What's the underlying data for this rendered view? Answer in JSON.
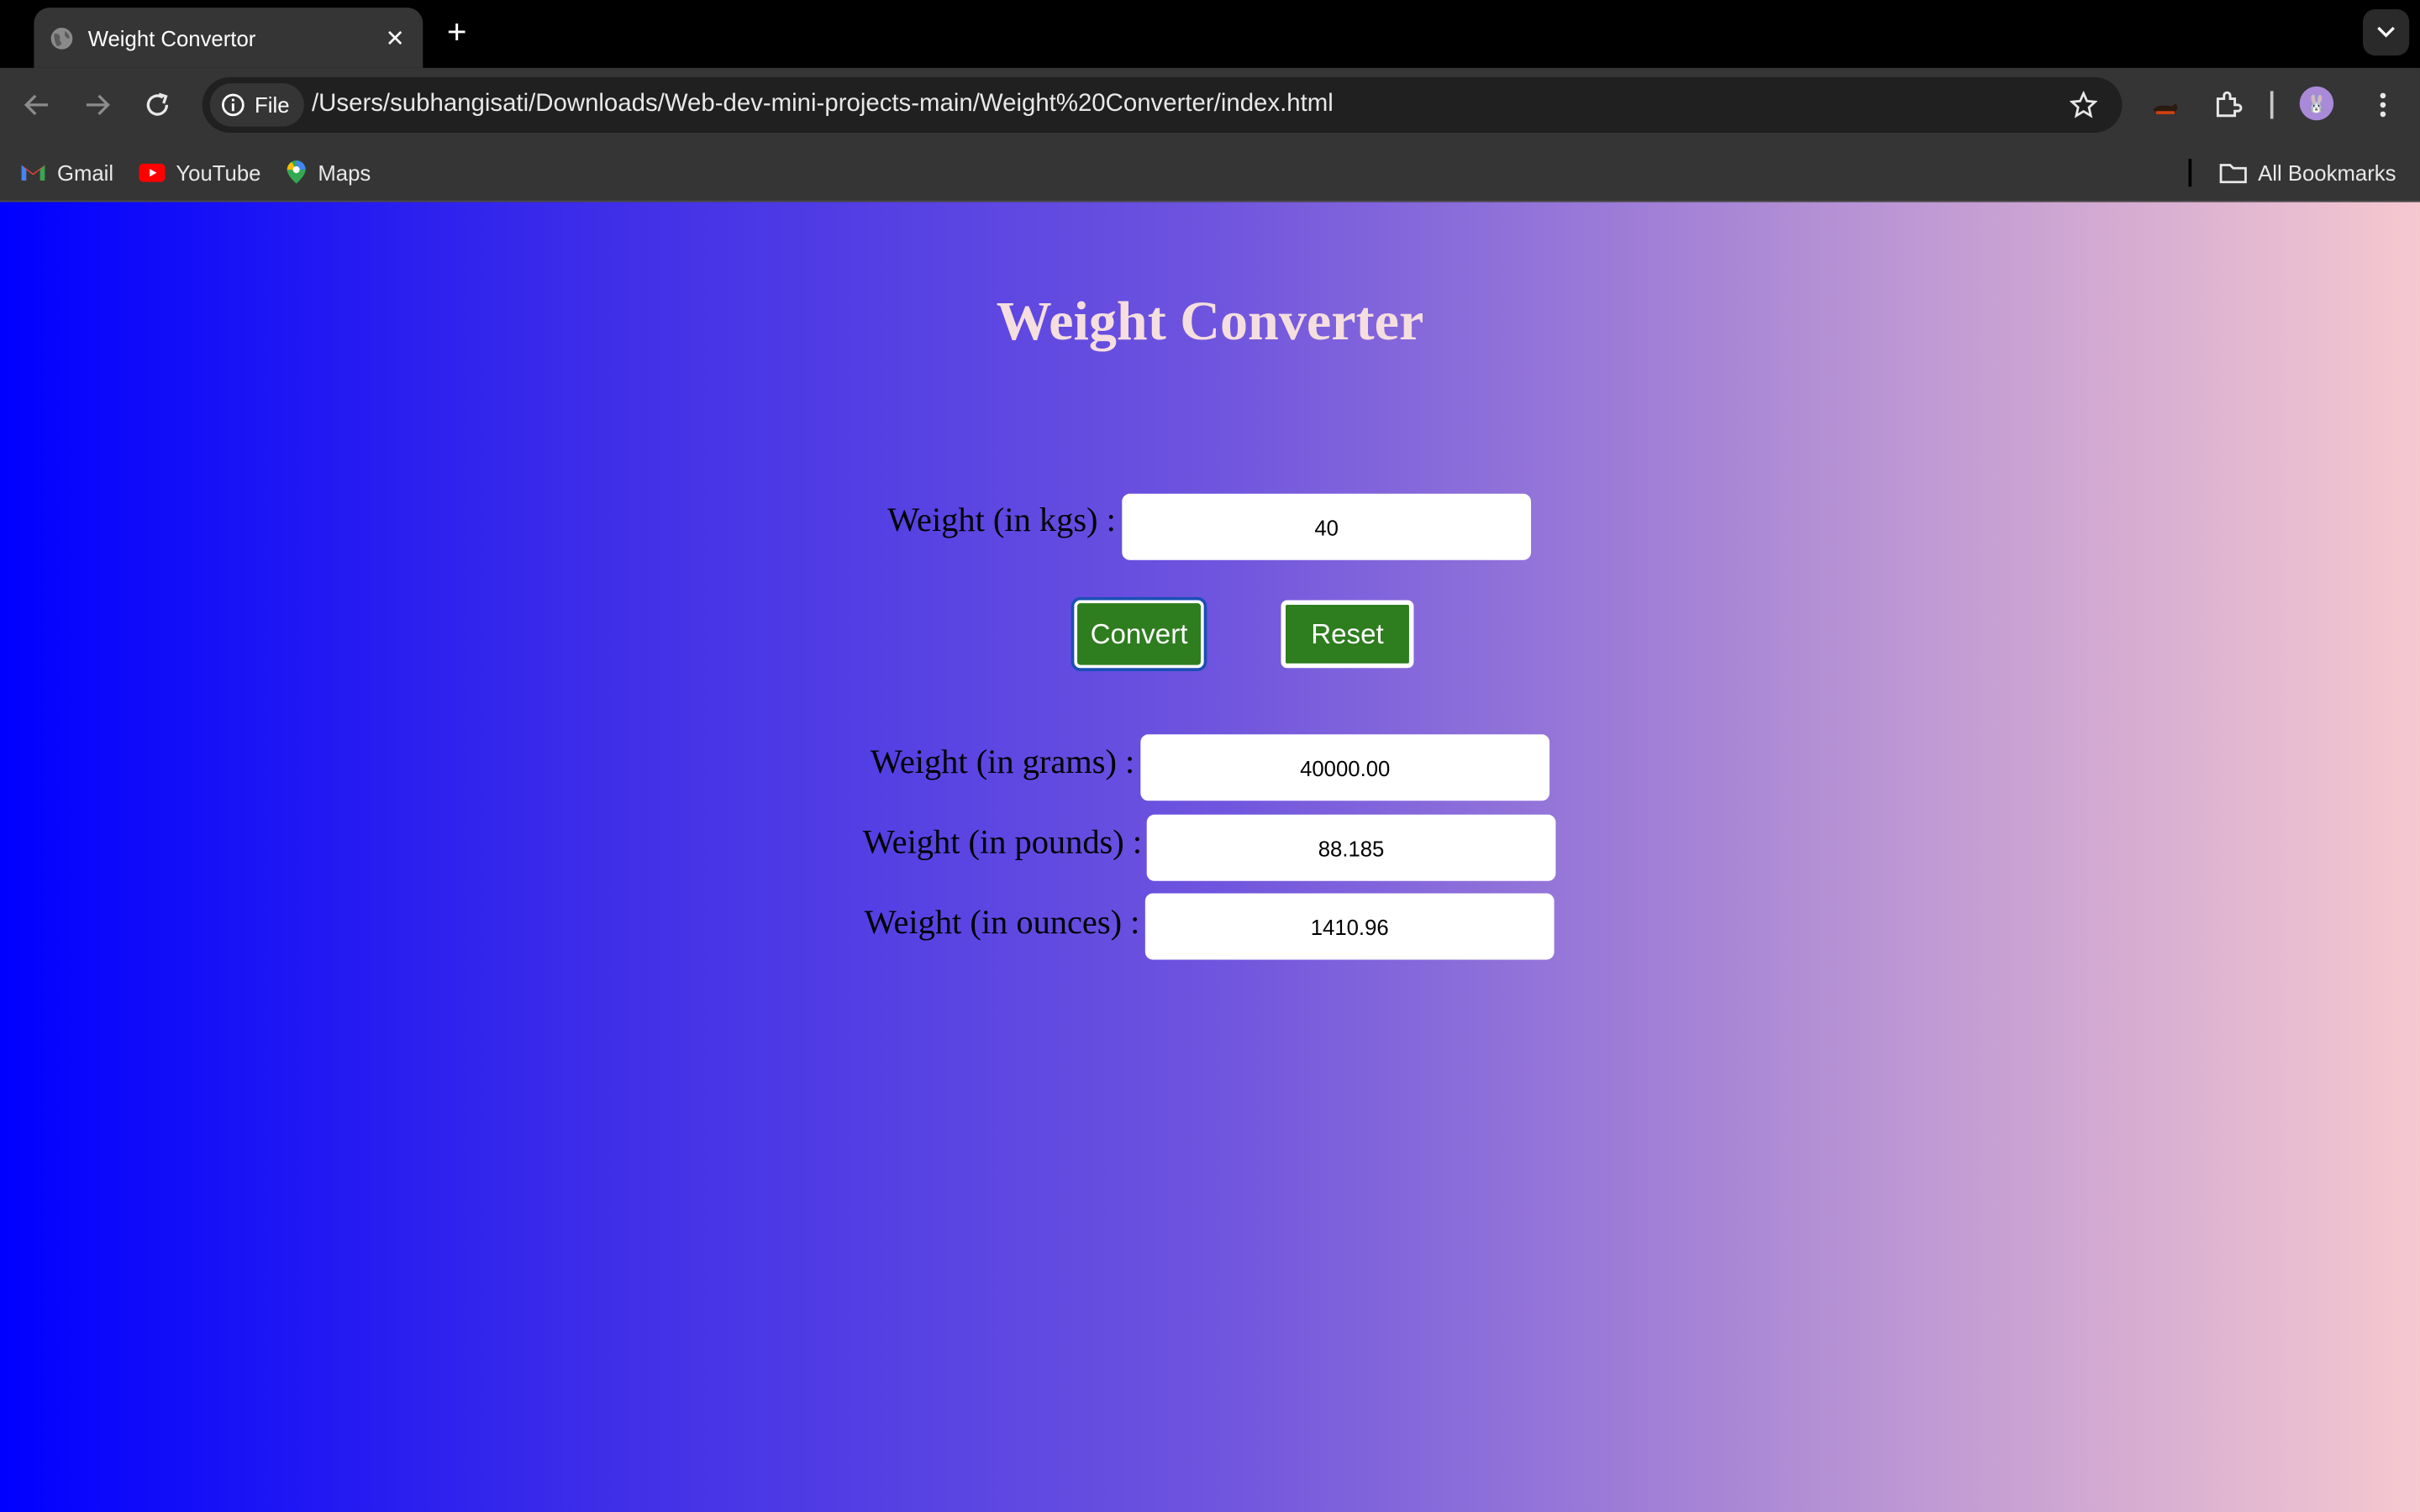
{
  "browser": {
    "tab": {
      "title": "Weight Convertor",
      "favicon": "globe-icon",
      "close": "✕"
    },
    "new_tab": "+",
    "toolbar": {
      "chip_label": "File",
      "url": "/Users/subhangisati/Downloads/Web-dev-mini-projects-main/Weight%20Converter/index.html"
    },
    "bookmarks": [
      {
        "label": "Gmail",
        "icon": "gmail-icon"
      },
      {
        "label": "YouTube",
        "icon": "youtube-icon"
      },
      {
        "label": "Maps",
        "icon": "maps-icon"
      }
    ],
    "all_bookmarks": "All Bookmarks",
    "avatar_glyph": "🐰"
  },
  "page": {
    "title": "Weight Converter",
    "kg_label": "Weight (in kgs) :",
    "kg_value": "40",
    "convert_label": "Convert",
    "reset_label": "Reset",
    "grams_label": "Weight (in grams) :",
    "grams_value": "40000.00",
    "pounds_label": "Weight (in pounds) :",
    "pounds_value": "88.185",
    "ounces_label": "Weight (in ounces) :",
    "ounces_value": "1410.96"
  },
  "colors": {
    "button": "#2e7d1f",
    "gradient_start": "#0000ff",
    "gradient_end": "#f6c8d0",
    "title": "#f5dede"
  }
}
